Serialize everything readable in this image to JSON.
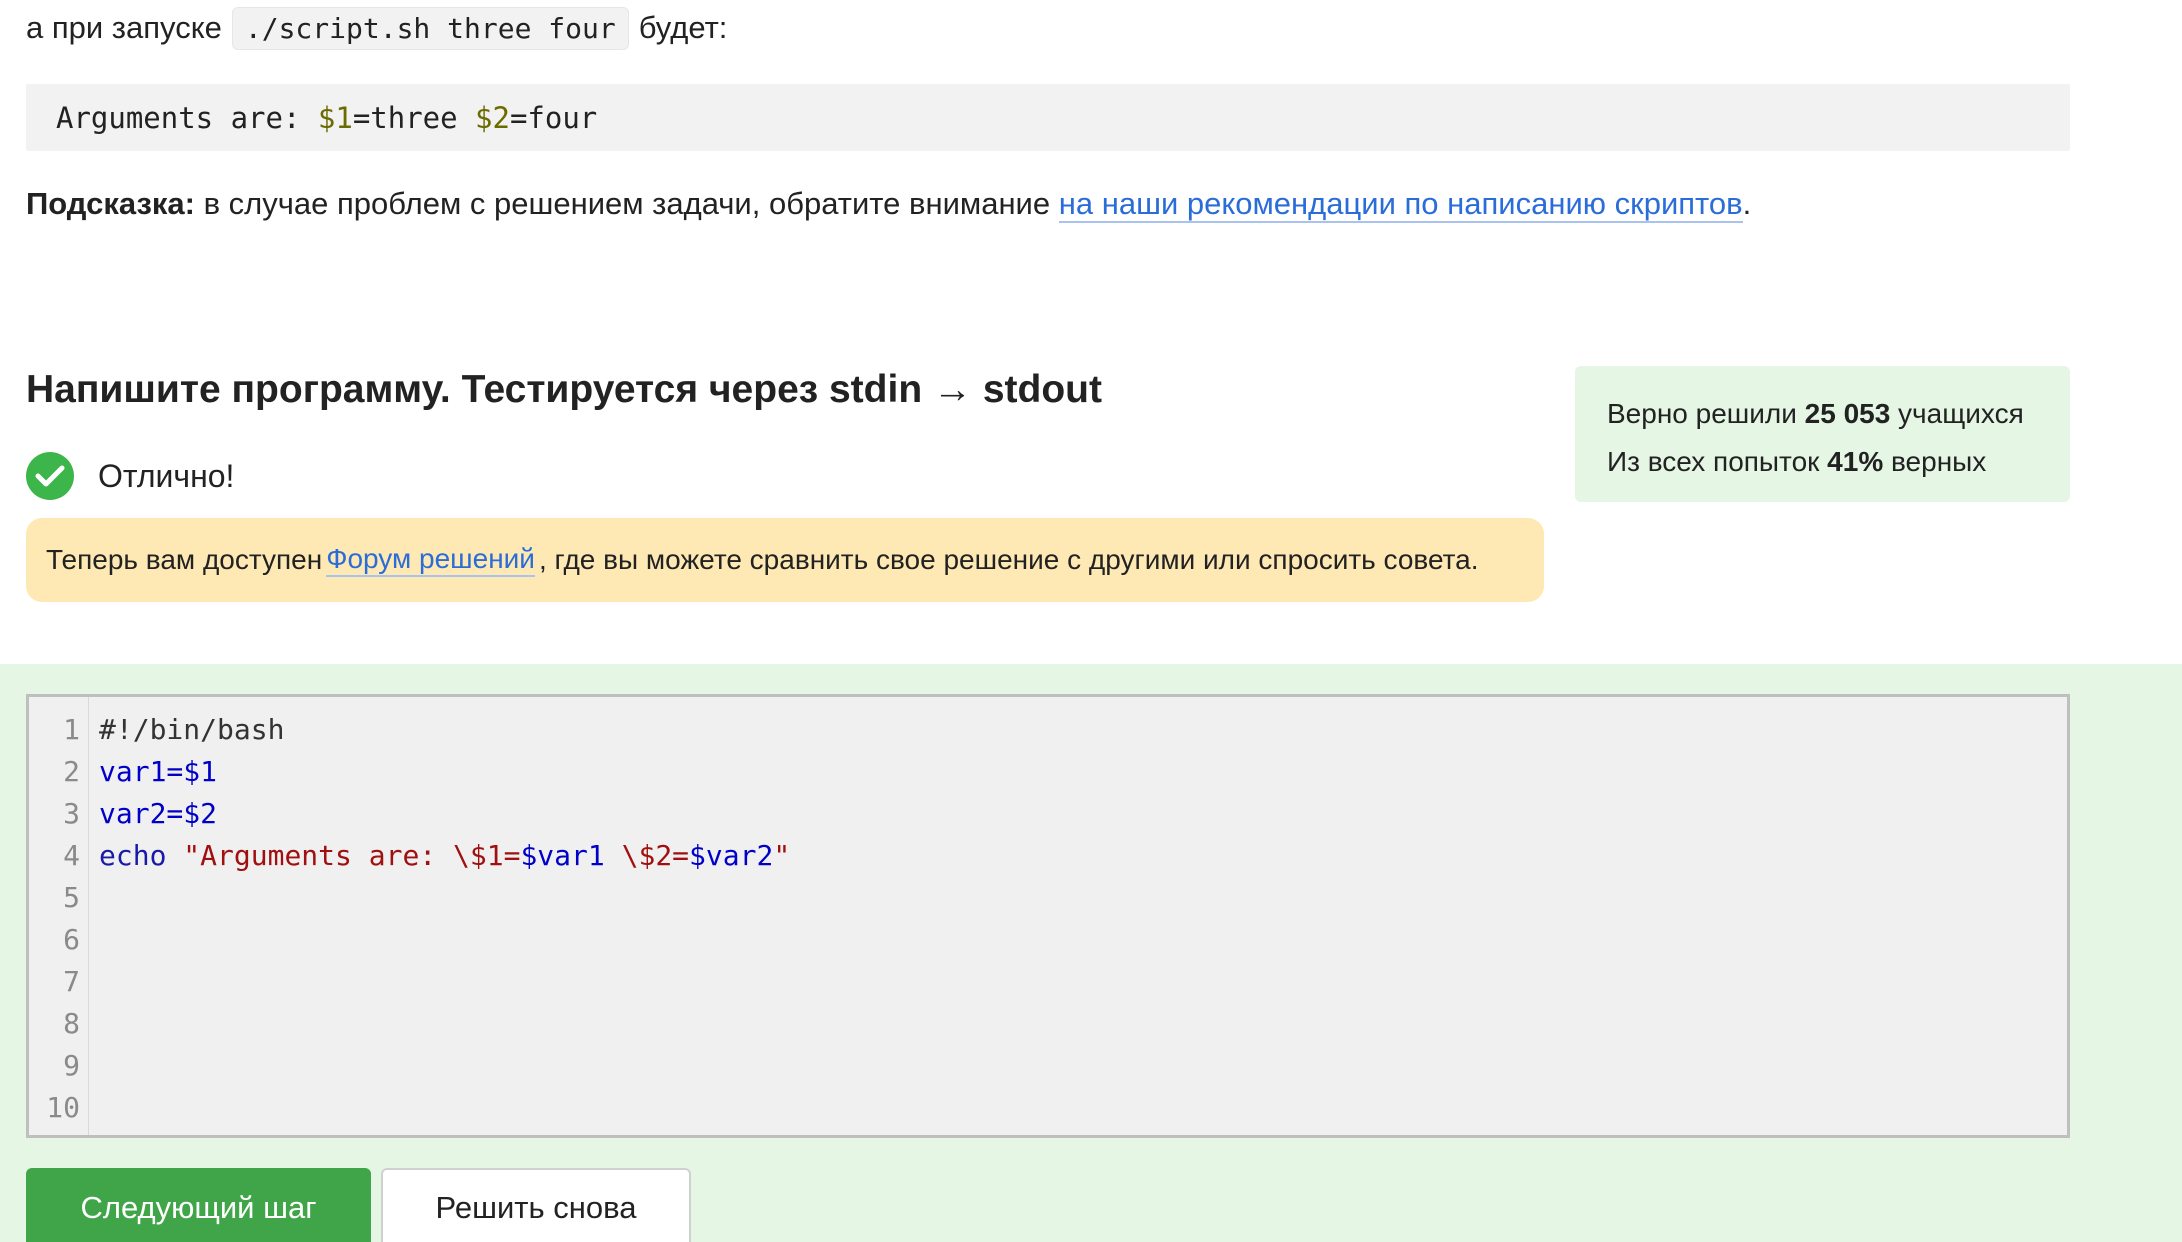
{
  "run_line": {
    "prefix": "а при запуске",
    "command": "./script.sh three four",
    "suffix": "будет:"
  },
  "output": {
    "text_before": "Arguments are: ",
    "var1": "$1",
    "eq1": "=three ",
    "var2": "$2",
    "eq2": "=four"
  },
  "hint": {
    "label": "Подсказка:",
    "text": " в случае проблем с решением задачи, обратите внимание ",
    "link": "на наши рекомендации по написанию скриптов",
    "end": "."
  },
  "task": {
    "title": "Напишите программу. Тестируется через stdin → stdout",
    "success": "Отлично!"
  },
  "forum": {
    "prefix": "Теперь вам доступен",
    "link": "Форум решений",
    "suffix": ", где вы можете сравнить свое решение с другими или спросить совета."
  },
  "stats": {
    "line1_prefix": "Верно решили ",
    "solved_count": "25 053",
    "line1_suffix": " учащихся",
    "line2_prefix": "Из всех попыток ",
    "percent": "41%",
    "line2_suffix": " верных"
  },
  "editor": {
    "line_numbers": [
      "1",
      "2",
      "3",
      "4",
      "5",
      "6",
      "7",
      "8",
      "9",
      "10"
    ],
    "line1": "#!/bin/bash",
    "line2_a": "var1=",
    "line2_b": "$1",
    "line3_a": "var2=",
    "line3_b": "$2",
    "line4_kw": "echo ",
    "line4_s1": "\"Arguments are: \\$1=",
    "line4_v1": "$var1",
    "line4_s2": " \\$2=",
    "line4_v2": "$var2",
    "line4_s3": "\""
  },
  "buttons": {
    "next": "Следующий шаг",
    "retry": "Решить снова"
  },
  "colors": {
    "success": "#3cb54a",
    "link": "#2a6dd9",
    "forum_bg": "#fee9b4",
    "stats_bg": "#e5f6e4",
    "next_button": "#40a449"
  }
}
